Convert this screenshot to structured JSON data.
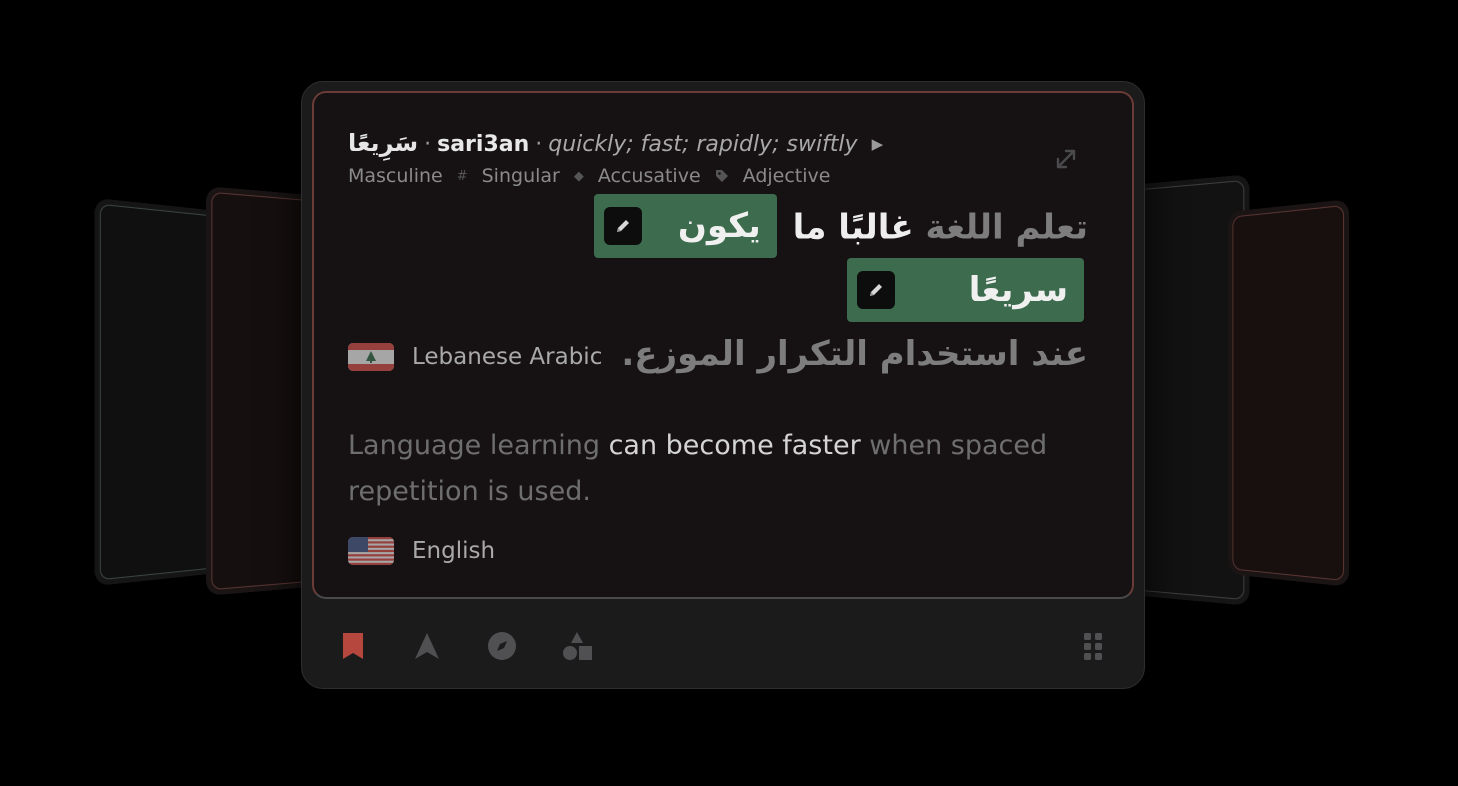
{
  "word": {
    "arabic": "سَرِيعًا",
    "transliteration": "sari3an",
    "gloss": "quickly; fast; rapidly; swiftly",
    "separator": "·"
  },
  "tags": [
    "Masculine",
    "Singular",
    "Accusative",
    "Adjective"
  ],
  "arabic_sentence": {
    "part1": "تعلم اللغة",
    "part2": "غالبًا ما",
    "chip1": "يكون",
    "chip2": "سريعًا",
    "line2": "عند استخدام التكرار الموزع."
  },
  "source_language": {
    "name": "Lebanese Arabic",
    "flag_icon": "lebanon-flag-icon"
  },
  "english_sentence": {
    "before": "Language learning ",
    "highlight": "can become faster",
    "after": " when spaced repetition is used."
  },
  "target_language": {
    "name": "English",
    "flag_icon": "usa-flag-icon"
  },
  "toolbar": {
    "icons": [
      "bookmark-icon",
      "navigate-icon",
      "compass-icon",
      "shapes-icon",
      "grid-menu-icon"
    ],
    "accent_color": "#c0504a"
  },
  "colors": {
    "background": "#000000",
    "card": "#1b1b1c",
    "highlight_chip": "#3d6b4d",
    "card_border": "#6a3b37"
  }
}
